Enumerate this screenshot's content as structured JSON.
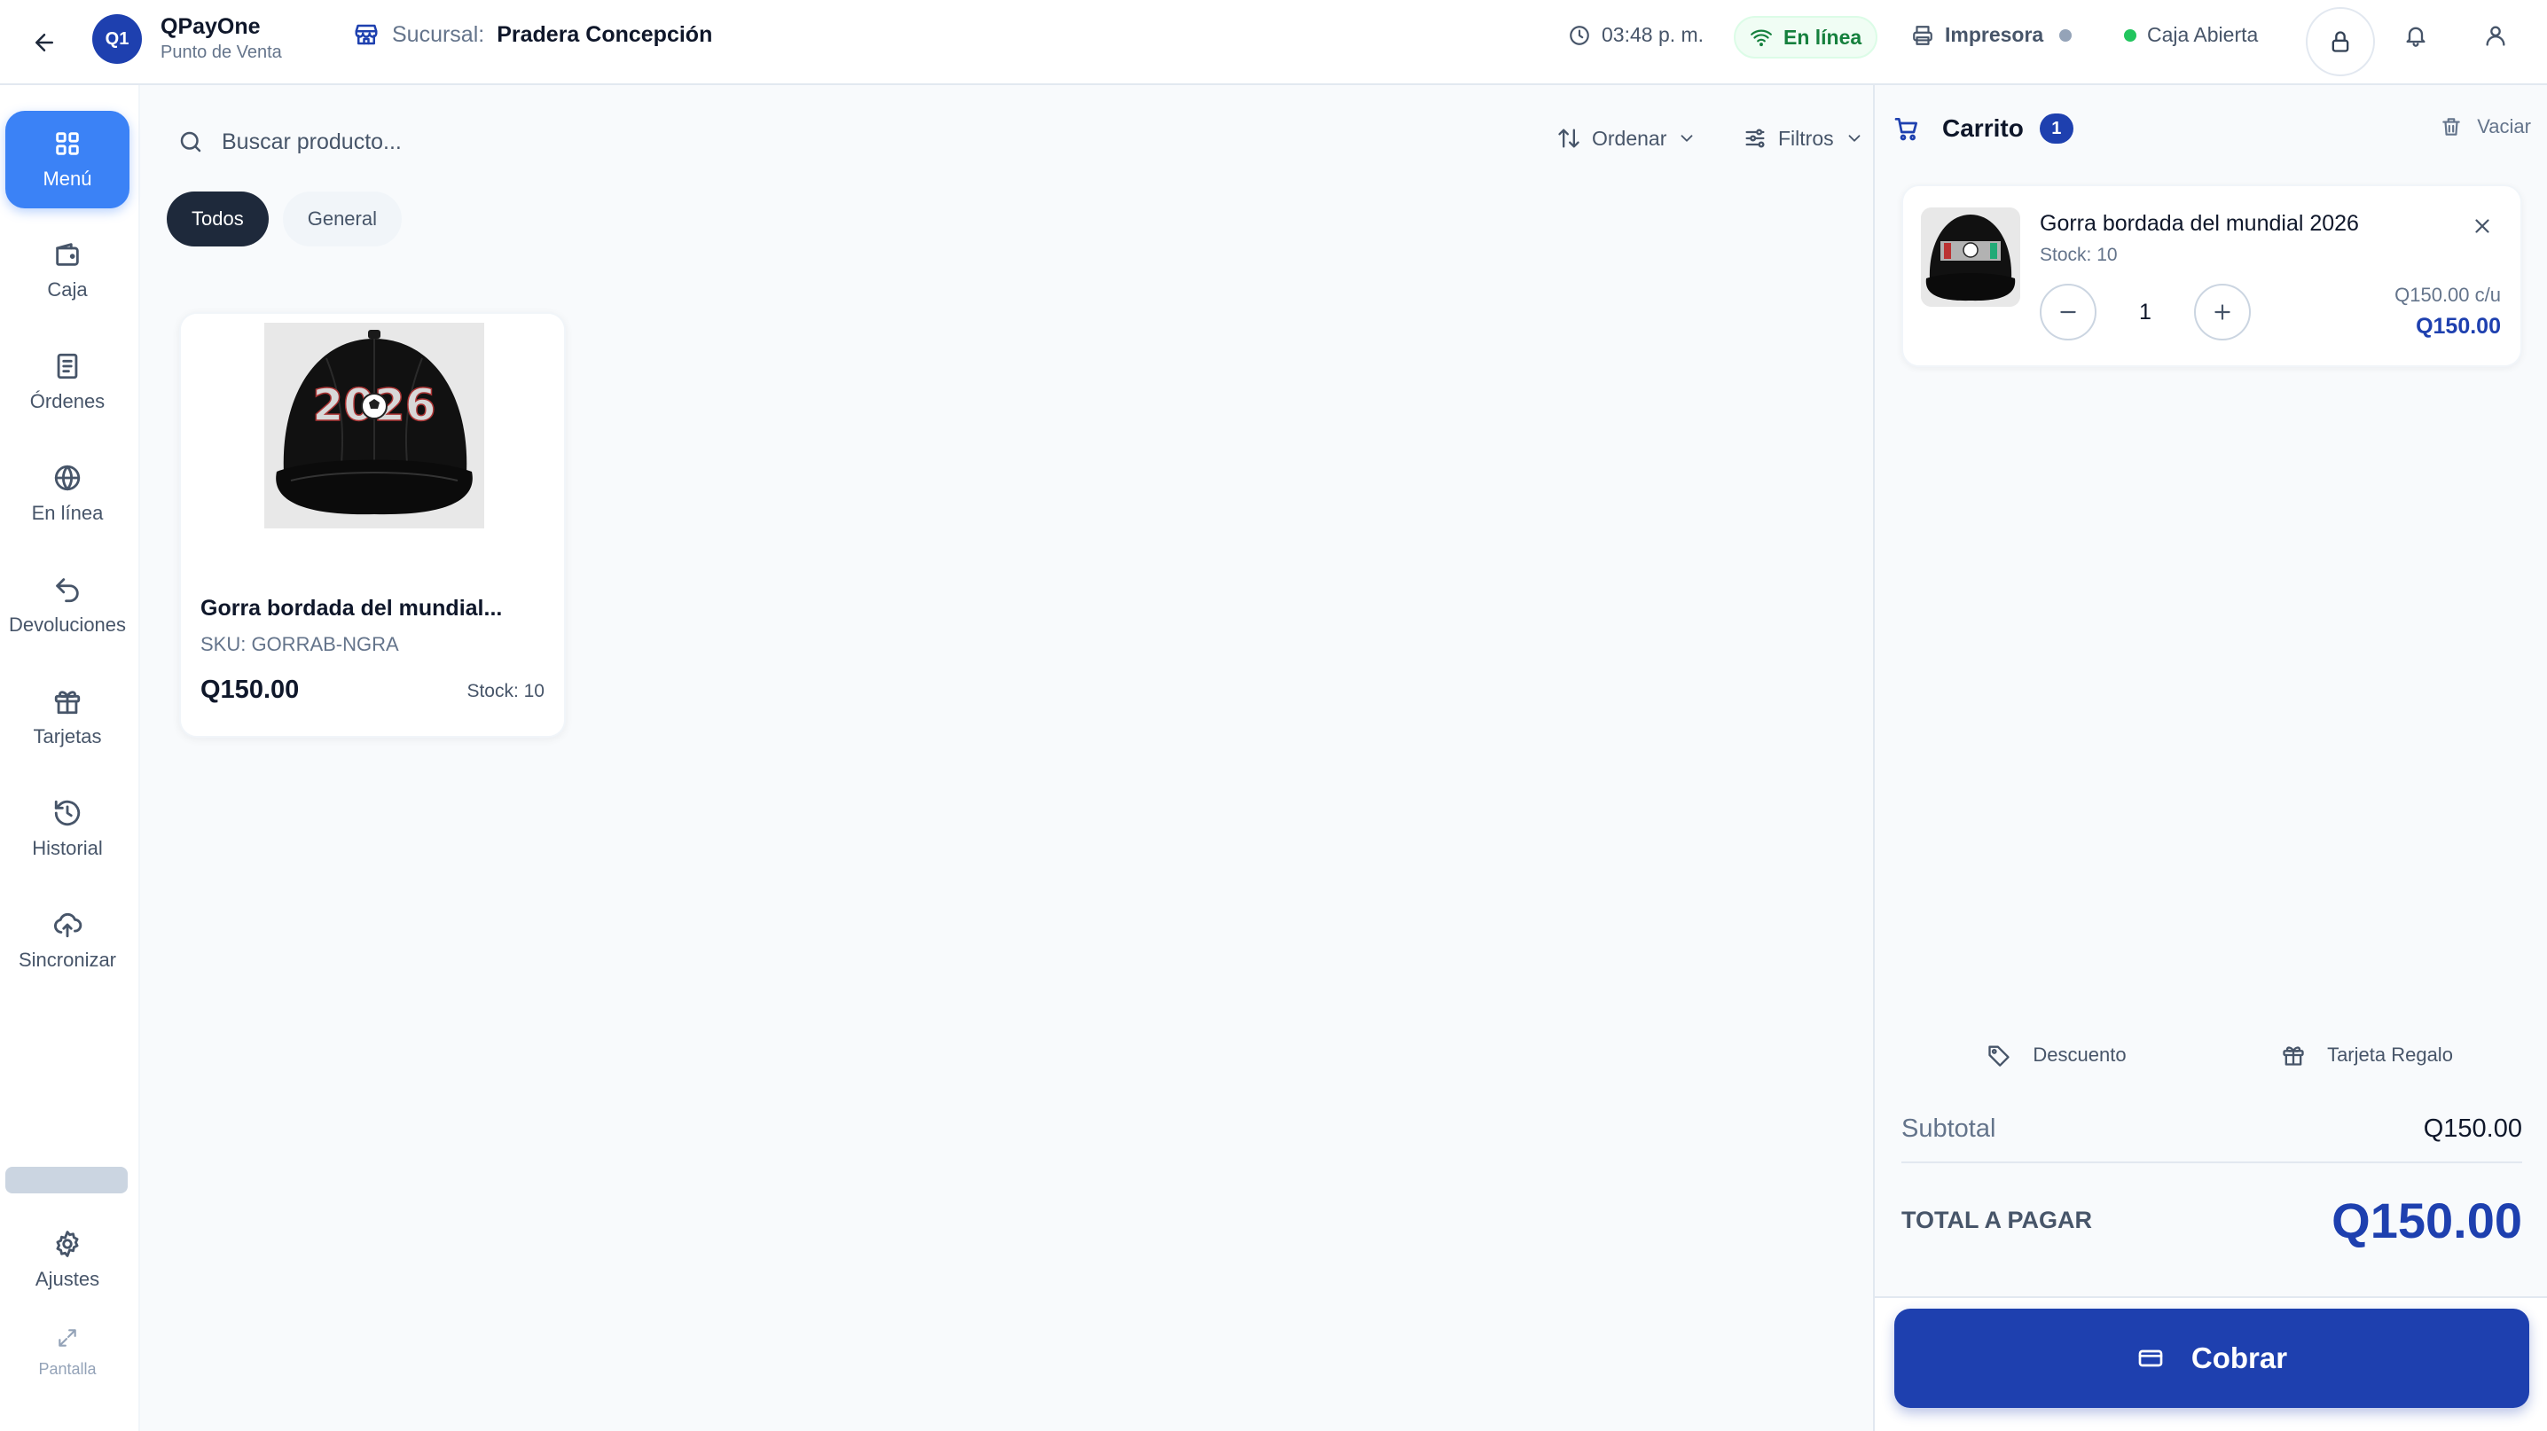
{
  "header": {
    "logo_text": "Q1",
    "app_name": "QPayOne",
    "app_subtitle": "Punto de Venta",
    "branch_label": "Sucursal:",
    "branch_name": "Pradera Concepción",
    "time": "03:48 p. m.",
    "connection_status": "En línea",
    "printer_label": "Impresora",
    "cash_status": "Caja Abierta"
  },
  "sidebar": {
    "items": [
      {
        "label": "Menú",
        "icon": "grid-icon"
      },
      {
        "label": "Caja",
        "icon": "wallet-icon"
      },
      {
        "label": "Órdenes",
        "icon": "receipt-icon"
      },
      {
        "label": "En línea",
        "icon": "globe-icon"
      },
      {
        "label": "Devoluciones",
        "icon": "undo-icon"
      },
      {
        "label": "Tarjetas",
        "icon": "gift-icon"
      },
      {
        "label": "Historial",
        "icon": "history-icon"
      },
      {
        "label": "Sincronizar",
        "icon": "cloud-upload-icon"
      }
    ],
    "settings_label": "Ajustes",
    "fullscreen_label": "Pantalla"
  },
  "main": {
    "search_placeholder": "Buscar producto...",
    "sort_label": "Ordenar",
    "filter_label": "Filtros",
    "tabs": [
      {
        "label": "Todos",
        "active": true
      },
      {
        "label": "General",
        "active": false
      }
    ],
    "products": [
      {
        "name": "Gorra bordada del mundial...",
        "sku": "SKU: GORRAB-NGRA",
        "price": "Q150.00",
        "stock": "Stock: 10",
        "image_text": "2026"
      }
    ]
  },
  "cart": {
    "title": "Carrito",
    "count": "1",
    "clear_label": "Vaciar",
    "items": [
      {
        "name": "Gorra bordada del mundial 2026",
        "stock": "Stock: 10",
        "quantity": "1",
        "unit_price": "Q150.00 c/u",
        "line_total": "Q150.00"
      }
    ],
    "discount_label": "Descuento",
    "gift_card_label": "Tarjeta Regalo",
    "subtotal_label": "Subtotal",
    "subtotal_value": "Q150.00",
    "total_label": "TOTAL A PAGAR",
    "total_value": "Q150.00",
    "charge_label": "Cobrar"
  },
  "colors": {
    "primary": "#1e40af",
    "active_nav": "#3b82f6",
    "online_green": "#15803d",
    "text_dark": "#0f172a",
    "text_muted": "#64748b"
  }
}
